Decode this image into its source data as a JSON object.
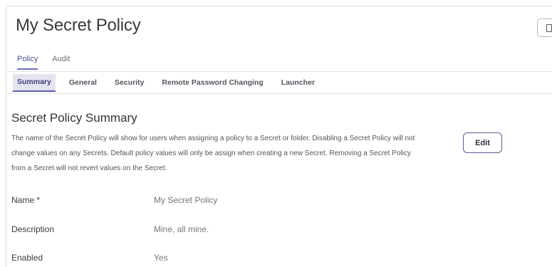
{
  "page": {
    "title": "My Secret Policy"
  },
  "tabs": [
    {
      "label": "Policy",
      "active": true
    },
    {
      "label": "Audit",
      "active": false
    }
  ],
  "subtabs": [
    {
      "label": "Summary",
      "active": true
    },
    {
      "label": "General",
      "active": false
    },
    {
      "label": "Security",
      "active": false
    },
    {
      "label": "Remote Password Changing",
      "active": false
    },
    {
      "label": "Launcher",
      "active": false
    }
  ],
  "section": {
    "title": "Secret Policy Summary",
    "description": "The name of the Secret Policy will show for users when assigning a policy to a Secret or folder. Disabling a Secret Policy will not change values on any Secrets. Default policy values will only be assign when creating a new Secret. Removing a Secret Policy from a Secret will not revert values on the Secret.",
    "edit_label": "Edit"
  },
  "fields": [
    {
      "label": "Name *",
      "value": "My Secret Policy"
    },
    {
      "label": "Description",
      "value": "Mine, all mine."
    },
    {
      "label": "Enabled",
      "value": "Yes"
    }
  ],
  "icons": {
    "corner_button": "document-icon"
  },
  "colors": {
    "accent": "#5b5bb0",
    "active_tab_bg": "#e4e4ee",
    "border": "#d9d9de"
  }
}
